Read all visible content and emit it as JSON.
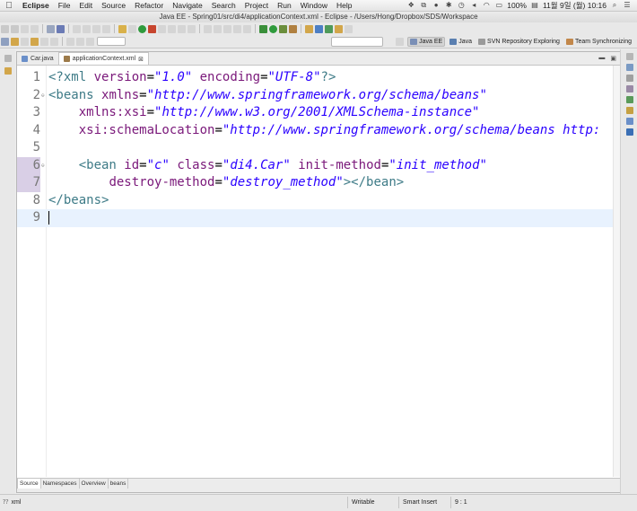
{
  "menubar": {
    "app_name": "Eclipse",
    "items": [
      "File",
      "Edit",
      "Source",
      "Refactor",
      "Navigate",
      "Search",
      "Project",
      "Run",
      "Window",
      "Help"
    ],
    "battery": "100%",
    "clock": "11월 9일 (월)  10:16"
  },
  "window": {
    "title": "Java EE - Spring01/src/di4/applicationContext.xml - Eclipse - /Users/Hong/Dropbox/SDS/Workspace"
  },
  "perspectives": {
    "items": [
      "Java EE",
      "Java",
      "SVN Repository Exploring",
      "Team Synchronizing"
    ]
  },
  "editor": {
    "tabs": [
      {
        "label": "Car.java",
        "active": false
      },
      {
        "label": "applicationContext.xml",
        "active": true,
        "close": "⊠"
      }
    ],
    "lines": [
      {
        "num": "1",
        "tokens": [
          {
            "t": "tag",
            "v": "<?xml "
          },
          {
            "t": "attr",
            "v": "version"
          },
          {
            "t": "plain",
            "v": "="
          },
          {
            "t": "val",
            "v": "\"1.0\""
          },
          {
            "t": "plain",
            "v": " "
          },
          {
            "t": "attr",
            "v": "encoding"
          },
          {
            "t": "plain",
            "v": "="
          },
          {
            "t": "val",
            "v": "\"UTF-8\""
          },
          {
            "t": "tag",
            "v": "?>"
          }
        ]
      },
      {
        "num": "2",
        "fold": "⊖",
        "tokens": [
          {
            "t": "tag",
            "v": "<beans "
          },
          {
            "t": "attr",
            "v": "xmlns"
          },
          {
            "t": "plain",
            "v": "="
          },
          {
            "t": "val",
            "v": "\"http://www.springframework.org/schema/beans\""
          }
        ]
      },
      {
        "num": "3",
        "tokens": [
          {
            "t": "plain",
            "v": "    "
          },
          {
            "t": "attr",
            "v": "xmlns:xsi"
          },
          {
            "t": "plain",
            "v": "="
          },
          {
            "t": "val",
            "v": "\"http://www.w3.org/2001/XMLSchema-instance\""
          }
        ]
      },
      {
        "num": "4",
        "tokens": [
          {
            "t": "plain",
            "v": "    "
          },
          {
            "t": "attr",
            "v": "xsi:schemaLocation"
          },
          {
            "t": "plain",
            "v": "="
          },
          {
            "t": "val",
            "v": "\"http://www.springframework.org/schema/beans http:"
          }
        ]
      },
      {
        "num": "5",
        "tokens": []
      },
      {
        "num": "6",
        "fold": "⊖",
        "marked": true,
        "tokens": [
          {
            "t": "plain",
            "v": "    "
          },
          {
            "t": "tag",
            "v": "<bean "
          },
          {
            "t": "attr",
            "v": "id"
          },
          {
            "t": "plain",
            "v": "="
          },
          {
            "t": "val",
            "v": "\"c\""
          },
          {
            "t": "plain",
            "v": " "
          },
          {
            "t": "attr",
            "v": "class"
          },
          {
            "t": "plain",
            "v": "="
          },
          {
            "t": "val",
            "v": "\"di4.Car\""
          },
          {
            "t": "plain",
            "v": " "
          },
          {
            "t": "attr",
            "v": "init-method"
          },
          {
            "t": "plain",
            "v": "="
          },
          {
            "t": "val",
            "v": "\"init_method\""
          }
        ]
      },
      {
        "num": "7",
        "marked": true,
        "tokens": [
          {
            "t": "plain",
            "v": "        "
          },
          {
            "t": "attr",
            "v": "destroy-method"
          },
          {
            "t": "plain",
            "v": "="
          },
          {
            "t": "val",
            "v": "\"destroy_method\""
          },
          {
            "t": "tag",
            "v": "></bean>"
          }
        ]
      },
      {
        "num": "8",
        "tokens": [
          {
            "t": "tag",
            "v": "</beans>"
          }
        ]
      },
      {
        "num": "9",
        "current": true,
        "tokens": []
      }
    ],
    "bottom_tabs": [
      "Source",
      "Namespaces",
      "Overview",
      "beans"
    ]
  },
  "statusbar": {
    "node": "xml",
    "writable": "Writable",
    "insert_mode": "Smart Insert",
    "position": "9 : 1"
  },
  "colors": {
    "tag": "#3e7b87",
    "attr": "#7a187a",
    "value": "#2a00ff",
    "current_line": "#e8f2fe"
  }
}
